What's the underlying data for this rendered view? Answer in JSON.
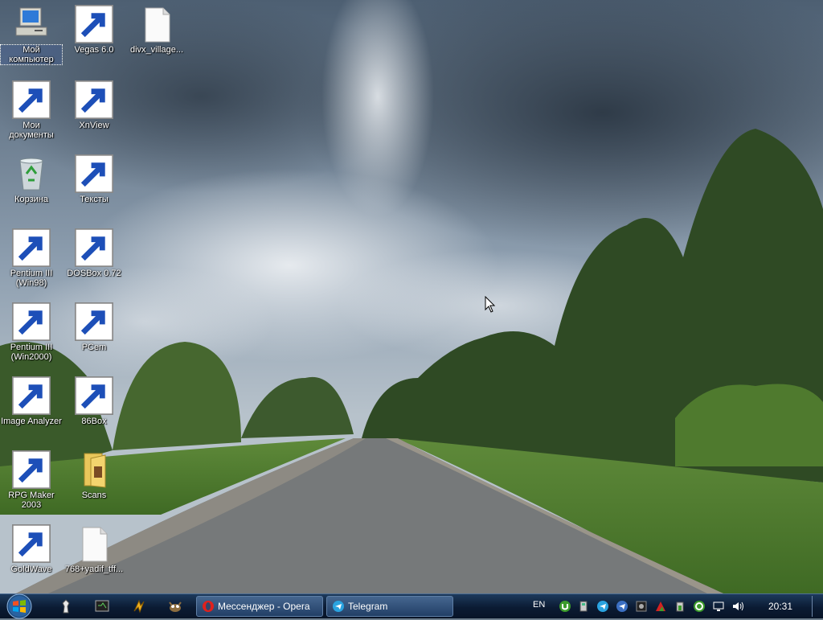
{
  "desktop": {
    "icons": [
      {
        "label": "Мой компьютер",
        "icon": "my-computer-icon"
      },
      {
        "label": "Vegas 6.0",
        "icon": "vegas-icon"
      },
      {
        "label": "divx_village...",
        "icon": "file-icon"
      },
      {
        "label": "Мои документы",
        "icon": "my-documents-icon"
      },
      {
        "label": "XnView",
        "icon": "xnview-icon"
      },
      {
        "label": "Корзина",
        "icon": "recycle-bin-icon"
      },
      {
        "label": "Тексты",
        "icon": "text-document-icon"
      },
      {
        "label": "Pentium III (Win98)",
        "icon": "network-computer-icon"
      },
      {
        "label": "DOSBox 0.72",
        "icon": "dosbox-icon"
      },
      {
        "label": "Pentium III (Win2000)",
        "icon": "network-computer-icon"
      },
      {
        "label": "PCem",
        "icon": "pcem-icon"
      },
      {
        "label": "Image Analyzer",
        "icon": "image-analyzer-icon"
      },
      {
        "label": "86Box",
        "icon": "86box-icon"
      },
      {
        "label": "RPG Maker 2003",
        "icon": "rpg-maker-icon"
      },
      {
        "label": "Scans",
        "icon": "folder-icon"
      },
      {
        "label": "GoldWave",
        "icon": "goldwave-icon"
      },
      {
        "label": "768+yadif_tff...",
        "icon": "file-icon"
      }
    ]
  },
  "taskbar": {
    "tasks": [
      {
        "label": "Мессенджер - Opera",
        "icon": "opera-icon"
      },
      {
        "label": "Telegram",
        "icon": "telegram-icon"
      }
    ],
    "language": "EN",
    "clock": "20:31",
    "colors": {
      "taskbar": "#0b1b33",
      "task_button": "#2f5078"
    }
  }
}
